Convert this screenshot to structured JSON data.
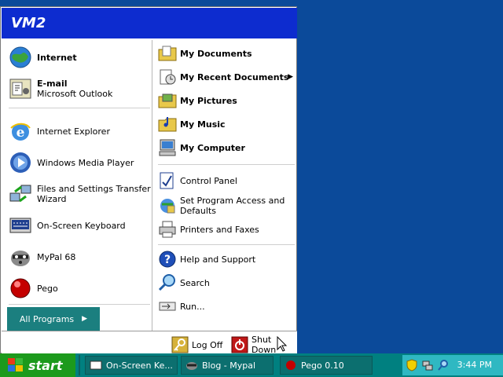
{
  "start_menu": {
    "username": "VM2",
    "pinned": [
      {
        "label": "Internet",
        "icon": "internet-globe-icon"
      },
      {
        "label": "E-mail",
        "sub": "Microsoft Outlook",
        "icon": "outlook-email-icon"
      }
    ],
    "recent": [
      {
        "label": "Internet Explorer",
        "icon": "internet-explorer-icon"
      },
      {
        "label": "Windows Media Player",
        "icon": "media-player-icon"
      },
      {
        "label": "Files and Settings Transfer",
        "sub": "Wizard",
        "icon": "transfer-wizard-icon"
      },
      {
        "label": "On-Screen Keyboard",
        "icon": "keyboard-icon"
      },
      {
        "label": "MyPal 68",
        "icon": "mypal-raccoon-icon"
      },
      {
        "label": "Pego",
        "icon": "pego-red-ball-icon"
      }
    ],
    "all_programs": "All Programs",
    "right": {
      "group1": [
        {
          "label": "My Documents",
          "icon": "documents-folder-icon"
        },
        {
          "label": "My Recent Documents",
          "icon": "recent-documents-icon",
          "has_submenu": true
        },
        {
          "label": "My Pictures",
          "icon": "pictures-folder-icon"
        },
        {
          "label": "My Music",
          "icon": "music-folder-icon"
        },
        {
          "label": "My Computer",
          "icon": "computer-icon"
        }
      ],
      "group2": [
        {
          "label": "Control Panel",
          "icon": "control-panel-icon"
        },
        {
          "label": "Set Program Access and",
          "sub": "Defaults",
          "icon": "program-access-icon"
        },
        {
          "label": "Printers and Faxes",
          "icon": "printer-icon"
        }
      ],
      "group3": [
        {
          "label": "Help and Support",
          "icon": "help-icon"
        },
        {
          "label": "Search",
          "icon": "search-icon"
        },
        {
          "label": "Run...",
          "icon": "run-icon"
        }
      ]
    },
    "footer": {
      "log_off": "Log Off",
      "shut_down": "Shut Down"
    }
  },
  "taskbar": {
    "start_label": "start",
    "tasks": [
      {
        "label": "On-Screen Ke..."
      },
      {
        "label": "Blog - Mypal"
      },
      {
        "label": "Pego 0.10"
      }
    ],
    "clock": "3:44 PM"
  },
  "colors": {
    "desktop": "#0b4a9a",
    "header": "#0d2ccf",
    "taskbar": "#008080",
    "start_button": "#1c9a1c",
    "tray": "#2fb8c2"
  }
}
